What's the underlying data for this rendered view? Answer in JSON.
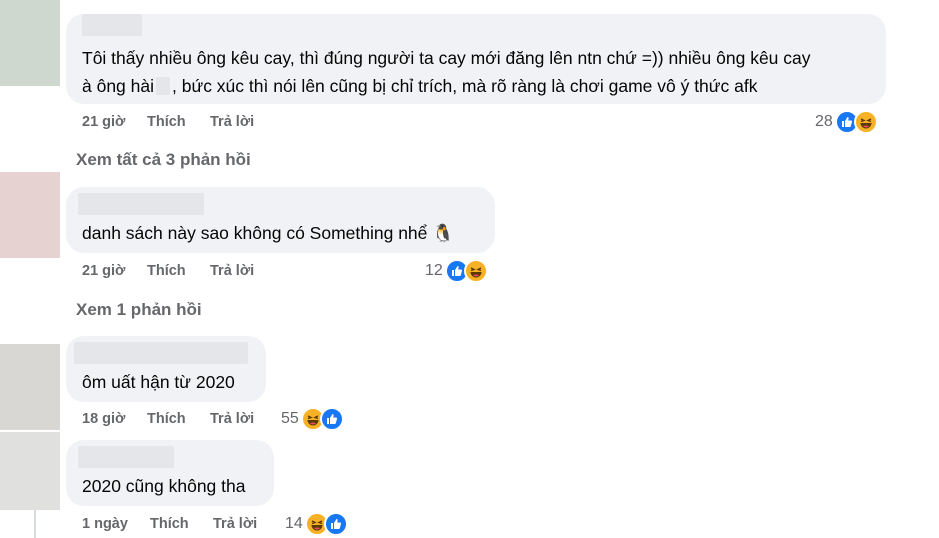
{
  "comments": [
    {
      "text_part1": "Tôi thấy nhiều ông kêu cay, thì đúng người ta cay mới đăng lên ntn chứ =)) nhiều ông kêu cay\nà ông hài",
      "text_part2": ", bức xúc thì nói lên cũng bị chỉ trích, mà rõ ràng là chơi game vô ý thức afk",
      "time": "21 giờ",
      "like": "Thích",
      "reply": "Trả lời",
      "reaction_count": "28",
      "avatar_color": "#cfd8cf"
    },
    {
      "text": "danh sách này sao không có Something nhể 🐧",
      "time": "21 giờ",
      "like": "Thích",
      "reply": "Trả lời",
      "reaction_count": "12",
      "avatar_color": "#e6d2d1"
    },
    {
      "text": "ôm uất hận từ 2020",
      "time": "18 giờ",
      "like": "Thích",
      "reply": "Trả lời",
      "reaction_count": "55",
      "avatar_color": "#d9d7d4"
    },
    {
      "text": "2020 cũng không tha",
      "time": "1 ngày",
      "like": "Thích",
      "reply": "Trả lời",
      "reaction_count": "14",
      "avatar_color": "#e0e0de"
    }
  ],
  "view_replies": [
    {
      "label": "Xem tất cả 3 phản hồi"
    },
    {
      "label": "Xem 1 phản hồi"
    }
  ],
  "icons": {
    "like": "like-icon",
    "haha": "haha-icon"
  },
  "colors": {
    "like_blue": "#1877f2",
    "haha_yellow": "#f7b125",
    "bubble_bg": "#f0f2f5",
    "meta_gray": "#65676b"
  }
}
